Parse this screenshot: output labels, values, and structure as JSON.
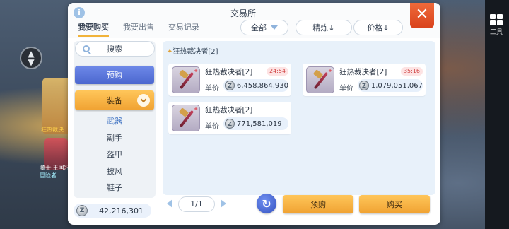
{
  "window": {
    "title": "交易所"
  },
  "tabs": [
    {
      "label": "我要购买",
      "active": true
    },
    {
      "label": "我要出售",
      "active": false
    },
    {
      "label": "交易记录",
      "active": false
    }
  ],
  "filters": {
    "category": "全部",
    "refine": "精炼↓",
    "price": "价格↓"
  },
  "sidebar": {
    "search_label": "搜索",
    "preorder_label": "预购",
    "equip_label": "装备",
    "subcategories": [
      "武器",
      "副手",
      "盔甲",
      "披风",
      "鞋子"
    ],
    "active_subcategory": "武器"
  },
  "balance": "42,216,301",
  "listing": {
    "header": "狂热裁决者[2]",
    "items": [
      {
        "name": "狂热裁决者[2]",
        "timer": "24:54",
        "price_label": "单价",
        "price": "6,458,864,930"
      },
      {
        "name": "狂热裁决者[2]",
        "timer": "35:16",
        "price_label": "单价",
        "price": "1,079,051,067"
      },
      {
        "name": "狂热裁决者[2]",
        "timer": "",
        "price_label": "单价",
        "price": "771,581,019"
      }
    ]
  },
  "pager": {
    "page": "1/1"
  },
  "actions": {
    "preorder_label": "预购",
    "buy_label": "购买"
  },
  "hud": {
    "tools_label": "工具",
    "name_top": "狂热裁决",
    "name_mid": "骑士·王国冠军",
    "name_bottom": "冒险者"
  },
  "colors": {
    "accent_orange": "#f0a232",
    "accent_blue": "#4b67cf",
    "close_red": "#d9421c"
  }
}
